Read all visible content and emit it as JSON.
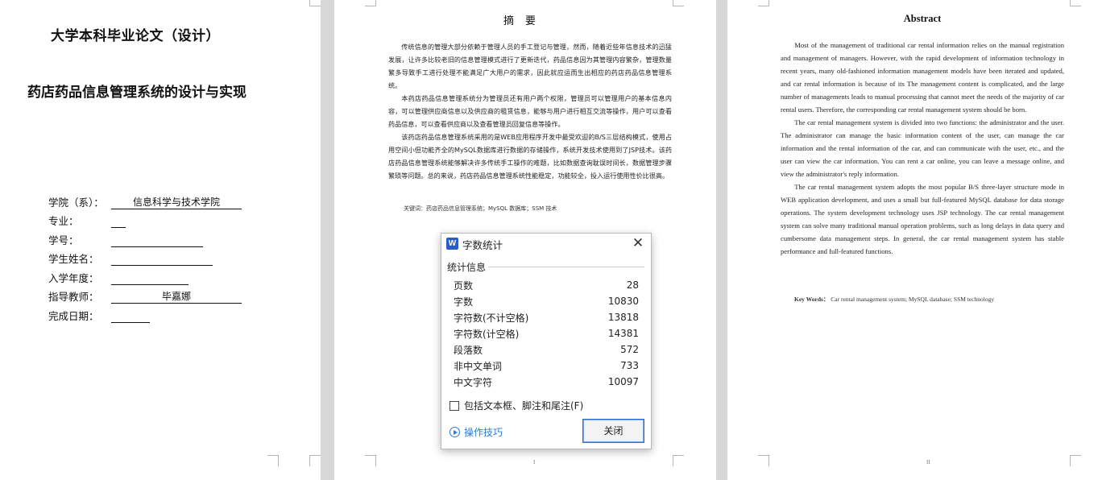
{
  "page1": {
    "university_title": "大学本科毕业论文（设计）",
    "thesis_title": "药店药品信息管理系统的设计与实现",
    "info_rows": [
      {
        "label": "学院（系）：",
        "value": "信息科学与技术学院"
      },
      {
        "label": "专业：",
        "value": ""
      },
      {
        "label": "学号：",
        "value": ""
      },
      {
        "label": "学生姓名：",
        "value": ""
      },
      {
        "label": "入学年度：",
        "value": ""
      },
      {
        "label": "指导教师：",
        "value": "毕嘉娜"
      },
      {
        "label": "完成日期：",
        "value": ""
      }
    ]
  },
  "page2": {
    "heading": "摘要",
    "paragraphs": [
      "传统信息的管理大部分依赖于管理人员的手工登记与管理，然而，随着近些年信息技术的迅猛发展，让许多比较老旧的信息管理模式进行了更新迭代，药品信息因为其管理内容繁杂，管理数量繁多导致手工进行处理不能满足广大用户的需求，因此就应运而生出相应的药店药品信息管理系统。",
      "本药店药品信息管理系统分为管理员还有用户两个权限，管理员可以管理用户的基本信息内容，可以管理供应商信息以及供应商的租赁信息，能够与用户进行相互交流等操作，用户可以查看药品信息，可以查看供应商以及查看管理员回复信息等操作。",
      "该药店药品信息管理系统采用的是WEB应用程序开发中最受欢迎的B/S三层结构模式，使用占用空间小但功能齐全的MySQL数据库进行数据的存储操作，系统开发技术使用到了JSP技术。该药店药品信息管理系统能够解决许多传统手工操作的难题，比如数据查询耽误时间长，数据管理步骤繁琐等问题。总的来说，药店药品信息管理系统性能稳定，功能较全，投入运行使用性价比很高。"
    ],
    "keywords": "关键词：药店药品信息管理系统；MySQL 数据库；SSM 技术",
    "page_number": "I"
  },
  "page3": {
    "heading": "Abstract",
    "paragraphs": [
      "Most of the management of traditional car rental information relies on the manual registration and management of managers. However, with the rapid development of information technology in recent years, many old-fashioned information management models have been iterated and updated, and car rental information is because of its The management content is complicated, and the large number of managements leads to manual processing that cannot meet the needs of the majority of car rental users. Therefore, the corresponding car rental management system should be born.",
      "The car rental management system is divided into two functions: the administrator and the user. The administrator can manage the basic information content of the user, can manage the car information and the rental information of the car, and can communicate with the user, etc., and the user can view the car information. You can rent a car online, you can leave a message online, and view the administrator's reply information.",
      "The car rental management system adopts the most popular B/S three-layer structure mode in WEB application development, and uses a small but full-featured MySQL database for data storage operations. The system development technology uses JSP technology. The car rental management system can solve many traditional manual operation problems, such as long delays in data query and cumbersome data management steps. In general, the car rental management system has stable performance and full-featured functions."
    ],
    "keywords_label": "Key Words：",
    "keywords": "Car rental management system; MySQL database; SSM technology",
    "page_number": "II"
  },
  "dialog": {
    "app_icon": "W",
    "title": "字数统计",
    "section_label": "统计信息",
    "stats": [
      {
        "label": "页数",
        "value": "28"
      },
      {
        "label": "字数",
        "value": "10830"
      },
      {
        "label": "字符数(不计空格)",
        "value": "13818"
      },
      {
        "label": "字符数(计空格)",
        "value": "14381"
      },
      {
        "label": "段落数",
        "value": "572"
      },
      {
        "label": "非中文单词",
        "value": "733"
      },
      {
        "label": "中文字符",
        "value": "10097"
      }
    ],
    "checkbox_label": "包括文本框、脚注和尾注(F)",
    "tips_label": "操作技巧",
    "close_button": "关闭",
    "close_glyph": "✕"
  }
}
